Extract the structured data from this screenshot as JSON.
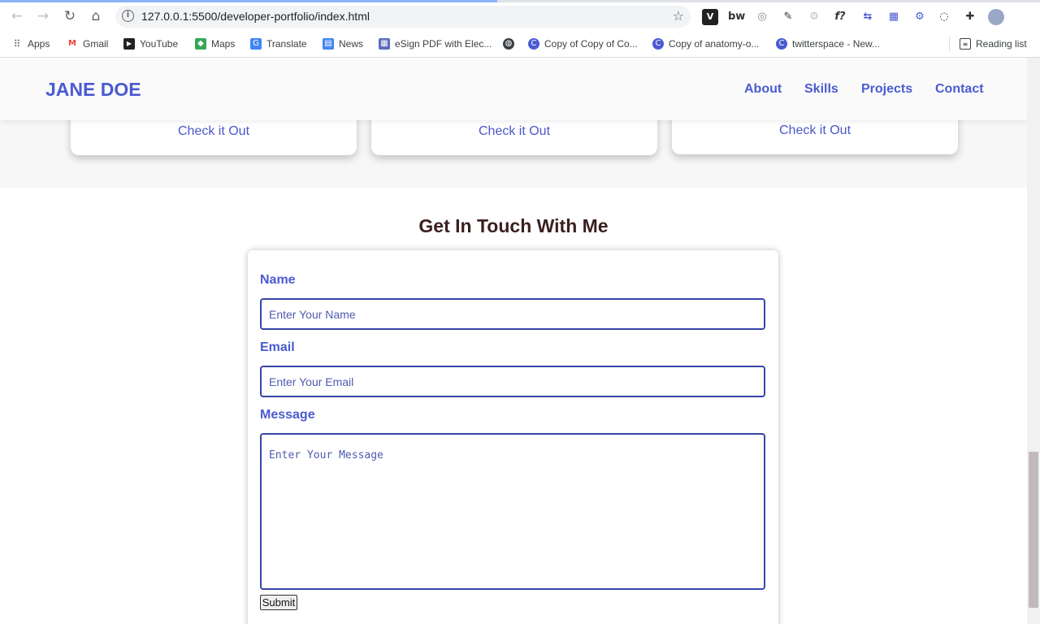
{
  "browser": {
    "url": "127.0.0.1:5500/developer-portfolio/index.html",
    "bookmarks": [
      {
        "label": "Apps",
        "icon": "apps-grid-icon",
        "color": "#5f6368"
      },
      {
        "label": "Gmail",
        "icon": "gmail-icon",
        "color": "#ea4335"
      },
      {
        "label": "YouTube",
        "icon": "youtube-icon",
        "color": "#222222"
      },
      {
        "label": "Maps",
        "icon": "maps-icon",
        "color": "#34a853"
      },
      {
        "label": "Translate",
        "icon": "translate-icon",
        "color": "#4285f4"
      },
      {
        "label": "News",
        "icon": "news-icon",
        "color": "#4285f4"
      },
      {
        "label": "eSign PDF with Elec...",
        "icon": "esign-icon",
        "color": "#5c6bc0"
      },
      {
        "label": "",
        "icon": "globe-icon",
        "color": "#3c4043"
      },
      {
        "label": "Copy of Copy of Co...",
        "icon": "doc-c-icon",
        "color": "#4a5bd1"
      },
      {
        "label": "Copy of anatomy-o...",
        "icon": "doc-c-icon",
        "color": "#4a5bd1"
      },
      {
        "label": "twitterspace - New...",
        "icon": "doc-c-icon",
        "color": "#4a5bd1"
      }
    ],
    "reading_list": "Reading list",
    "extensions": [
      "ext-1",
      "bw",
      "ext-3",
      "ext-4",
      "ext-5",
      "f?",
      "ext-7",
      "ext-8",
      "ext-9",
      "ext-10",
      "extensions-puzzle",
      "profile"
    ]
  },
  "header": {
    "brand": "JANE DOE",
    "nav": [
      "About",
      "Skills",
      "Projects",
      "Contact"
    ]
  },
  "projects": {
    "cards": [
      {
        "link": "Check it Out"
      },
      {
        "link": "Check it Out"
      },
      {
        "link": "Check it Out"
      }
    ]
  },
  "contact": {
    "title": "Get In Touch With Me",
    "name_label": "Name",
    "name_placeholder": "Enter Your Name",
    "email_label": "Email",
    "email_placeholder": "Enter Your Email",
    "message_label": "Message",
    "message_placeholder": "Enter Your Message",
    "submit": "Submit"
  },
  "colors": {
    "accent": "#4a5bd1",
    "title": "#3a1f1f",
    "input_border": "#3645a8"
  }
}
